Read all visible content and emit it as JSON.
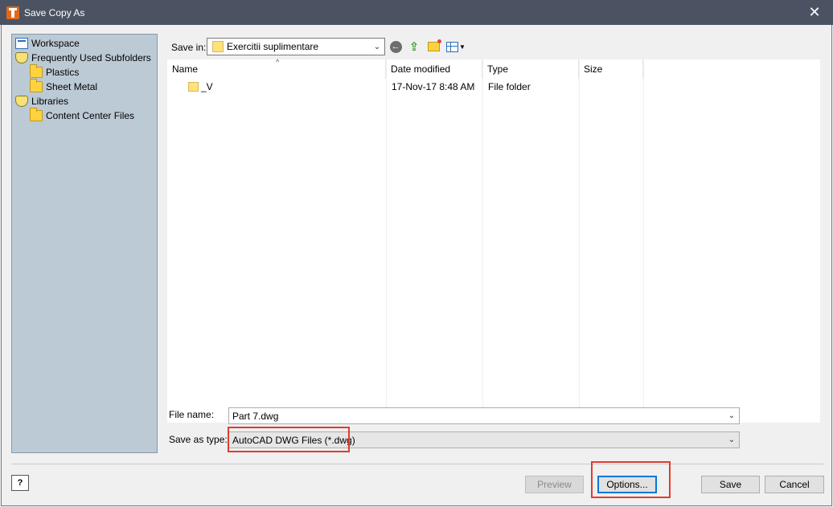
{
  "window": {
    "title": "Save Copy As",
    "close_glyph": "✕"
  },
  "sidebar": {
    "items": [
      {
        "label": "Workspace",
        "icon": "workspace-icon",
        "level": 0
      },
      {
        "label": "Frequently Used Subfolders",
        "icon": "library-icon",
        "level": 0
      },
      {
        "label": "Plastics",
        "icon": "folder-icon",
        "level": 1
      },
      {
        "label": "Sheet Metal",
        "icon": "folder-icon",
        "level": 1
      },
      {
        "label": "Libraries",
        "icon": "library-icon",
        "level": 0
      },
      {
        "label": "Content Center Files",
        "icon": "folder-icon",
        "level": 1
      }
    ]
  },
  "save_in": {
    "label": "Save in:",
    "value": "Exercitii suplimentare"
  },
  "file_list": {
    "columns": [
      "Name",
      "Date modified",
      "Type",
      "Size"
    ],
    "rows": [
      {
        "name": "_V",
        "date": "17-Nov-17 8:48 AM",
        "type": "File folder",
        "size": ""
      }
    ]
  },
  "file_name": {
    "label": "File name:",
    "value": "Part 7.dwg"
  },
  "save_as_type": {
    "label": "Save as type:",
    "value": "AutoCAD DWG Files (*.dwg)"
  },
  "buttons": {
    "help": "?",
    "preview": "Preview",
    "options": "Options...",
    "save": "Save",
    "cancel": "Cancel"
  },
  "colors": {
    "titlebar": "#4b5363",
    "sidebar": "#bccad6",
    "highlight": "#e03c31"
  }
}
